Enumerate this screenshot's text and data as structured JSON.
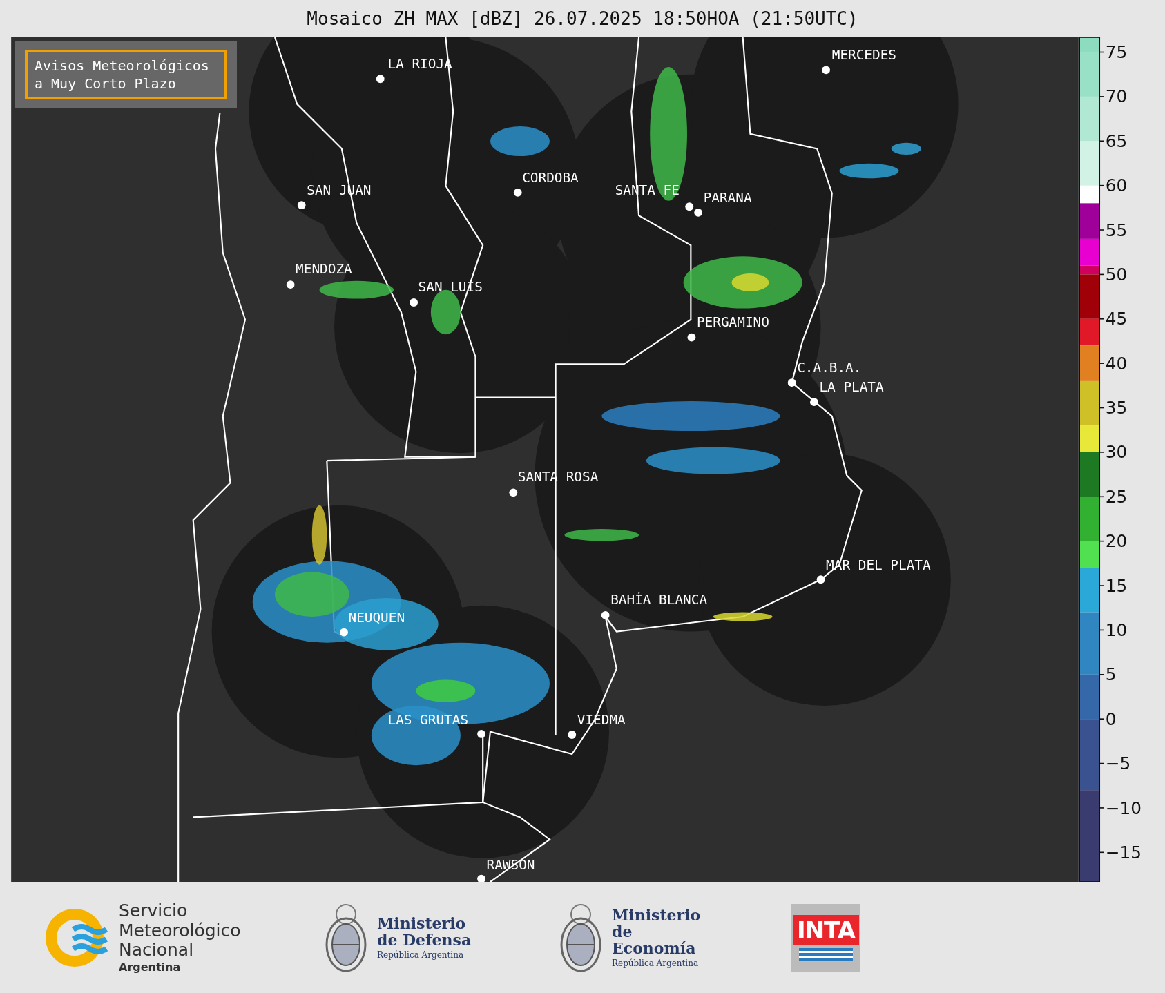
{
  "title": "Mosaico ZH MAX [dBZ] 26.07.2025 18:50HOA (21:50UTC)",
  "notice": {
    "text": "Avisos Meteorológicos a Muy Corto Plazo"
  },
  "cities": [
    {
      "name": "LA RIOJA"
    },
    {
      "name": "MERCEDES"
    },
    {
      "name": "CORDOBA"
    },
    {
      "name": "SAN JUAN"
    },
    {
      "name": "SANTA FE"
    },
    {
      "name": "PARANA"
    },
    {
      "name": "MENDOZA"
    },
    {
      "name": "SAN LUIS"
    },
    {
      "name": "PERGAMINO"
    },
    {
      "name": "C.A.B.A."
    },
    {
      "name": "LA PLATA"
    },
    {
      "name": "SANTA ROSA"
    },
    {
      "name": "MAR DEL PLATA"
    },
    {
      "name": "BAHÍA BLANCA"
    },
    {
      "name": "NEUQUEN"
    },
    {
      "name": "LAS GRUTAS"
    },
    {
      "name": "VIEDMA"
    },
    {
      "name": "RAWSON"
    }
  ],
  "colorbar": {
    "ticks": [
      "75",
      "70",
      "65",
      "60",
      "55",
      "50",
      "45",
      "40",
      "35",
      "30",
      "25",
      "20",
      "15",
      "10",
      "5",
      "0",
      "−5",
      "−10",
      "−15"
    ]
  },
  "logos": [
    {
      "kind": "smn",
      "name": "Servicio Meteorológico Nacional",
      "subtitle": "Argentina"
    },
    {
      "kind": "ministry",
      "name": "Ministerio de Defensa",
      "subtitle": "República Argentina"
    },
    {
      "kind": "ministry",
      "name": "Ministerio de Economía",
      "subtitle": "República Argentina"
    },
    {
      "kind": "inta",
      "name": "INTA"
    }
  ]
}
